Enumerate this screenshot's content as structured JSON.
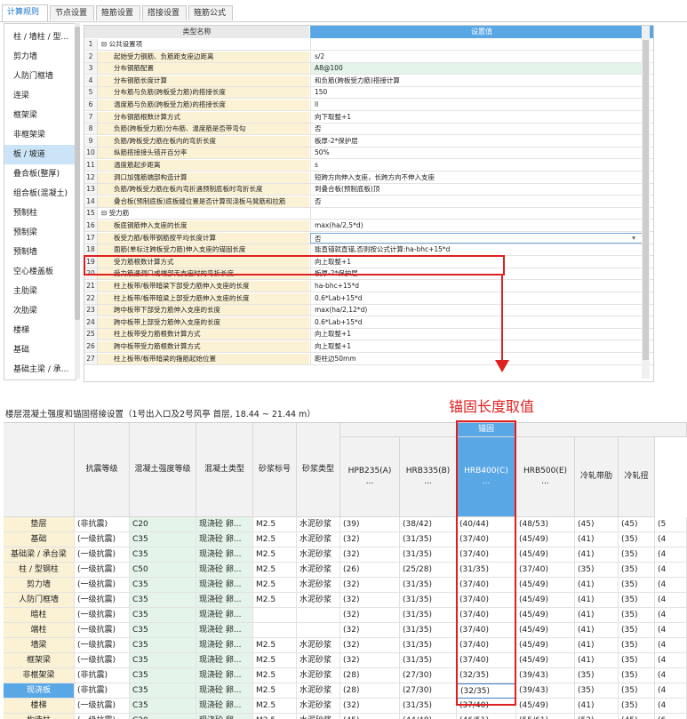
{
  "tabs": [
    "计算规则",
    "节点设置",
    "箍筋设置",
    "搭接设置",
    "箍筋公式"
  ],
  "sidebar": [
    "柱 / 墙柱 / 型...",
    "剪力墙",
    "人防门框墙",
    "连梁",
    "框架梁",
    "非框架梁",
    "板 / 坡道",
    "叠合板(整厚)",
    "组合板(混凝土)",
    "预制柱",
    "预制梁",
    "预制墙",
    "空心楼盖板",
    "主肋梁",
    "次肋梁",
    "楼梯",
    "基础",
    "基础主梁 / 承...",
    "基础次梁"
  ],
  "settings": {
    "headers": {
      "name": "类型名称",
      "value": "设置值"
    },
    "rows": [
      {
        "num": "1",
        "name": "公共设置项",
        "value": "",
        "group": true
      },
      {
        "num": "2",
        "name": "起始受力钢筋、负筋距支座边距离",
        "value": "s/2"
      },
      {
        "num": "3",
        "name": "分布钢筋配置",
        "value": "A8@100"
      },
      {
        "num": "4",
        "name": "分布钢筋长度计算",
        "value": "和负筋(跨板受力筋)搭接计算"
      },
      {
        "num": "5",
        "name": "分布筋与负筋(跨板受力筋)的搭接长度",
        "value": "150"
      },
      {
        "num": "6",
        "name": "温度筋与负筋(跨板受力筋)的搭接长度",
        "value": "ll"
      },
      {
        "num": "7",
        "name": "分布钢筋根数计算方式",
        "value": "向下取整+1"
      },
      {
        "num": "8",
        "name": "负筋(跨板受力筋)分布筋、温度筋是否带弯勾",
        "value": "否"
      },
      {
        "num": "9",
        "name": "负筋/跨板受力筋在板内的弯折长度",
        "value": "板厚-2*保护层"
      },
      {
        "num": "10",
        "name": "纵筋搭接接头错开百分率",
        "value": "50%"
      },
      {
        "num": "11",
        "name": "温度筋起步距离",
        "value": "s"
      },
      {
        "num": "12",
        "name": "洞口加强筋端部构造计算",
        "value": "短跨方向伸入支座，长跨方向不伸入支座"
      },
      {
        "num": "13",
        "name": "负筋/跨板受力筋在板内弯折遇预制底板时弯折长度",
        "value": "到叠合板(预制底板)顶"
      },
      {
        "num": "14",
        "name": "叠合板(预制底板)底板缝位置是否计算现浇板马凳筋和拉筋",
        "value": "否"
      },
      {
        "num": "15",
        "name": "受力筋",
        "value": "",
        "group": true
      },
      {
        "num": "16",
        "name": "板底钢筋伸入支座的长度",
        "value": "max(ha/2,5*d)"
      },
      {
        "num": "17",
        "name": "板受力筋/板带钢筋按平均长度计算",
        "value": "否"
      },
      {
        "num": "18",
        "name": "面筋(单标注跨板受力筋)伸入支座的锚固长度",
        "value": "能直锚就直锚,否则按公式计算:ha-bhc+15*d"
      },
      {
        "num": "19",
        "name": "受力筋根数计算方式",
        "value": "向上取整+1"
      },
      {
        "num": "20",
        "name": "受力筋遇洞口或端部无支座时的弯折长度",
        "value": "板厚-2*保护层"
      },
      {
        "num": "21",
        "name": "柱上板带/板带暗梁下部受力筋伸入支座的长度",
        "value": "ha-bhc+15*d"
      },
      {
        "num": "22",
        "name": "柱上板带/板带暗梁上部受力筋伸入支座的长度",
        "value": "0.6*Lab+15*d"
      },
      {
        "num": "23",
        "name": "跨中板带下部受力筋伸入支座的长度",
        "value": "max(ha/2,12*d)"
      },
      {
        "num": "24",
        "name": "跨中板带上部受力筋伸入支座的长度",
        "value": "0.6*Lab+15*d"
      },
      {
        "num": "25",
        "name": "柱上板带受力筋根数计算方式",
        "value": "向上取整+1"
      },
      {
        "num": "26",
        "name": "跨中板带受力筋根数计算方式",
        "value": "向上取整+1"
      },
      {
        "num": "27",
        "name": "柱上板带/板带暗梁的箍筋起始位置",
        "value": "距柱边50mm"
      }
    ]
  },
  "annotation": "锚固长度取值",
  "panel_title": "楼层混凝土强度和锚固搭接设置（1号出入口及2号风亭 首层, 18.44 ~ 21.44 m）",
  "grid": {
    "group_header": "锚固",
    "headers": [
      "抗震等级",
      "混凝土强度等级",
      "混凝土类型",
      "砂浆标号",
      "砂浆类型",
      "HPB235(A)\n...",
      "HRB335(B)\n...",
      "HRB400(C)\n...",
      "HRB500(E)\n...",
      "冷轧带肋",
      "冷轧扭"
    ],
    "rows": [
      [
        "垫层",
        "(非抗震)",
        "C20",
        "现浇砼 卵...",
        "M2.5",
        "水泥砂浆",
        "(39)",
        "(38/42)",
        "(40/44)",
        "(48/53)",
        "(45)",
        "(45)",
        "(5"
      ],
      [
        "基础",
        "(一级抗震)",
        "C35",
        "现浇砼 卵...",
        "M2.5",
        "水泥砂浆",
        "(32)",
        "(31/35)",
        "(37/40)",
        "(45/49)",
        "(41)",
        "(35)",
        "(4"
      ],
      [
        "基础梁 / 承台梁",
        "(一级抗震)",
        "C35",
        "现浇砼 卵...",
        "M2.5",
        "水泥砂浆",
        "(32)",
        "(31/35)",
        "(37/40)",
        "(45/49)",
        "(41)",
        "(35)",
        "(4"
      ],
      [
        "柱 / 型钢柱",
        "(一级抗震)",
        "C50",
        "现浇砼 卵...",
        "M2.5",
        "水泥砂浆",
        "(26)",
        "(25/28)",
        "(31/35)",
        "(37/40)",
        "(35)",
        "(35)",
        "(4"
      ],
      [
        "剪力墙",
        "(一级抗震)",
        "C35",
        "现浇砼 卵...",
        "M2.5",
        "水泥砂浆",
        "(32)",
        "(31/35)",
        "(37/40)",
        "(45/49)",
        "(41)",
        "(35)",
        "(4"
      ],
      [
        "人防门框墙",
        "(一级抗震)",
        "C35",
        "现浇砼 卵...",
        "M2.5",
        "水泥砂浆",
        "(32)",
        "(31/35)",
        "(37/40)",
        "(45/49)",
        "(41)",
        "(35)",
        "(4"
      ],
      [
        "暗柱",
        "(一级抗震)",
        "C35",
        "现浇砼 卵...",
        "",
        "",
        "(32)",
        "(31/35)",
        "(37/40)",
        "(45/49)",
        "(41)",
        "(35)",
        "(4"
      ],
      [
        "端柱",
        "(一级抗震)",
        "C35",
        "现浇砼 卵...",
        "",
        "",
        "(32)",
        "(31/35)",
        "(37/40)",
        "(45/49)",
        "(41)",
        "(35)",
        "(4"
      ],
      [
        "墙梁",
        "(一级抗震)",
        "C35",
        "现浇砼 卵...",
        "M2.5",
        "水泥砂浆",
        "(32)",
        "(31/35)",
        "(37/40)",
        "(45/49)",
        "(41)",
        "(35)",
        "(4"
      ],
      [
        "框架梁",
        "(一级抗震)",
        "C35",
        "现浇砼 卵...",
        "M2.5",
        "水泥砂浆",
        "(32)",
        "(31/35)",
        "(37/40)",
        "(45/49)",
        "(41)",
        "(35)",
        "(4"
      ],
      [
        "非框架梁",
        "(非抗震)",
        "C35",
        "现浇砼 卵...",
        "M2.5",
        "水泥砂浆",
        "(28)",
        "(27/30)",
        "(32/35)",
        "(39/43)",
        "(35)",
        "(35)",
        "(4"
      ],
      [
        "现浇板",
        "(非抗震)",
        "C35",
        "现浇砼 卵...",
        "M2.5",
        "水泥砂浆",
        "(28)",
        "(27/30)",
        "(32/35)",
        "(39/43)",
        "(35)",
        "(35)",
        "(4"
      ],
      [
        "楼梯",
        "(一级抗震)",
        "C35",
        "现浇砼 卵...",
        "M2.5",
        "水泥砂浆",
        "(32)",
        "(31/35)",
        "(37/40)",
        "(45/49)",
        "(41)",
        "(35)",
        "(4"
      ],
      [
        "构造柱",
        "(一级抗震)",
        "C20",
        "现浇砼 卵...",
        "M2.5",
        "水泥砂浆",
        "(45)",
        "(44/48)",
        "(46/51)",
        "(55/61)",
        "(52)",
        "(45)",
        "(6"
      ],
      [
        "圈梁 / 过梁",
        "(一级抗震)",
        "C20",
        "现浇砼 卵...",
        "M2.5",
        "水泥砂浆",
        "(45)",
        "(44/48)",
        "(46/51)",
        "(55/61)",
        "(52)",
        "(45)",
        "(6"
      ]
    ]
  },
  "colors": {
    "accent": "#5aa7e6",
    "red": "#e02020",
    "name_bg": "#fbf2d6",
    "value_bg": "#e4f4ea"
  }
}
